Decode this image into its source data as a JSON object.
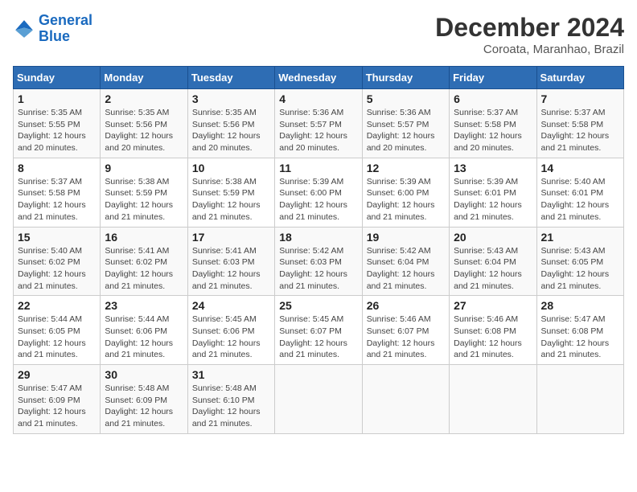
{
  "header": {
    "logo_line1": "General",
    "logo_line2": "Blue",
    "main_title": "December 2024",
    "subtitle": "Coroata, Maranhao, Brazil"
  },
  "calendar": {
    "days_of_week": [
      "Sunday",
      "Monday",
      "Tuesday",
      "Wednesday",
      "Thursday",
      "Friday",
      "Saturday"
    ],
    "weeks": [
      [
        {
          "day": "1",
          "sunrise": "5:35 AM",
          "sunset": "5:55 PM",
          "daylight": "12 hours and 20 minutes."
        },
        {
          "day": "2",
          "sunrise": "5:35 AM",
          "sunset": "5:56 PM",
          "daylight": "12 hours and 20 minutes."
        },
        {
          "day": "3",
          "sunrise": "5:35 AM",
          "sunset": "5:56 PM",
          "daylight": "12 hours and 20 minutes."
        },
        {
          "day": "4",
          "sunrise": "5:36 AM",
          "sunset": "5:57 PM",
          "daylight": "12 hours and 20 minutes."
        },
        {
          "day": "5",
          "sunrise": "5:36 AM",
          "sunset": "5:57 PM",
          "daylight": "12 hours and 20 minutes."
        },
        {
          "day": "6",
          "sunrise": "5:37 AM",
          "sunset": "5:58 PM",
          "daylight": "12 hours and 20 minutes."
        },
        {
          "day": "7",
          "sunrise": "5:37 AM",
          "sunset": "5:58 PM",
          "daylight": "12 hours and 21 minutes."
        }
      ],
      [
        {
          "day": "8",
          "sunrise": "5:37 AM",
          "sunset": "5:58 PM",
          "daylight": "12 hours and 21 minutes."
        },
        {
          "day": "9",
          "sunrise": "5:38 AM",
          "sunset": "5:59 PM",
          "daylight": "12 hours and 21 minutes."
        },
        {
          "day": "10",
          "sunrise": "5:38 AM",
          "sunset": "5:59 PM",
          "daylight": "12 hours and 21 minutes."
        },
        {
          "day": "11",
          "sunrise": "5:39 AM",
          "sunset": "6:00 PM",
          "daylight": "12 hours and 21 minutes."
        },
        {
          "day": "12",
          "sunrise": "5:39 AM",
          "sunset": "6:00 PM",
          "daylight": "12 hours and 21 minutes."
        },
        {
          "day": "13",
          "sunrise": "5:39 AM",
          "sunset": "6:01 PM",
          "daylight": "12 hours and 21 minutes."
        },
        {
          "day": "14",
          "sunrise": "5:40 AM",
          "sunset": "6:01 PM",
          "daylight": "12 hours and 21 minutes."
        }
      ],
      [
        {
          "day": "15",
          "sunrise": "5:40 AM",
          "sunset": "6:02 PM",
          "daylight": "12 hours and 21 minutes."
        },
        {
          "day": "16",
          "sunrise": "5:41 AM",
          "sunset": "6:02 PM",
          "daylight": "12 hours and 21 minutes."
        },
        {
          "day": "17",
          "sunrise": "5:41 AM",
          "sunset": "6:03 PM",
          "daylight": "12 hours and 21 minutes."
        },
        {
          "day": "18",
          "sunrise": "5:42 AM",
          "sunset": "6:03 PM",
          "daylight": "12 hours and 21 minutes."
        },
        {
          "day": "19",
          "sunrise": "5:42 AM",
          "sunset": "6:04 PM",
          "daylight": "12 hours and 21 minutes."
        },
        {
          "day": "20",
          "sunrise": "5:43 AM",
          "sunset": "6:04 PM",
          "daylight": "12 hours and 21 minutes."
        },
        {
          "day": "21",
          "sunrise": "5:43 AM",
          "sunset": "6:05 PM",
          "daylight": "12 hours and 21 minutes."
        }
      ],
      [
        {
          "day": "22",
          "sunrise": "5:44 AM",
          "sunset": "6:05 PM",
          "daylight": "12 hours and 21 minutes."
        },
        {
          "day": "23",
          "sunrise": "5:44 AM",
          "sunset": "6:06 PM",
          "daylight": "12 hours and 21 minutes."
        },
        {
          "day": "24",
          "sunrise": "5:45 AM",
          "sunset": "6:06 PM",
          "daylight": "12 hours and 21 minutes."
        },
        {
          "day": "25",
          "sunrise": "5:45 AM",
          "sunset": "6:07 PM",
          "daylight": "12 hours and 21 minutes."
        },
        {
          "day": "26",
          "sunrise": "5:46 AM",
          "sunset": "6:07 PM",
          "daylight": "12 hours and 21 minutes."
        },
        {
          "day": "27",
          "sunrise": "5:46 AM",
          "sunset": "6:08 PM",
          "daylight": "12 hours and 21 minutes."
        },
        {
          "day": "28",
          "sunrise": "5:47 AM",
          "sunset": "6:08 PM",
          "daylight": "12 hours and 21 minutes."
        }
      ],
      [
        {
          "day": "29",
          "sunrise": "5:47 AM",
          "sunset": "6:09 PM",
          "daylight": "12 hours and 21 minutes."
        },
        {
          "day": "30",
          "sunrise": "5:48 AM",
          "sunset": "6:09 PM",
          "daylight": "12 hours and 21 minutes."
        },
        {
          "day": "31",
          "sunrise": "5:48 AM",
          "sunset": "6:10 PM",
          "daylight": "12 hours and 21 minutes."
        },
        null,
        null,
        null,
        null
      ]
    ]
  }
}
